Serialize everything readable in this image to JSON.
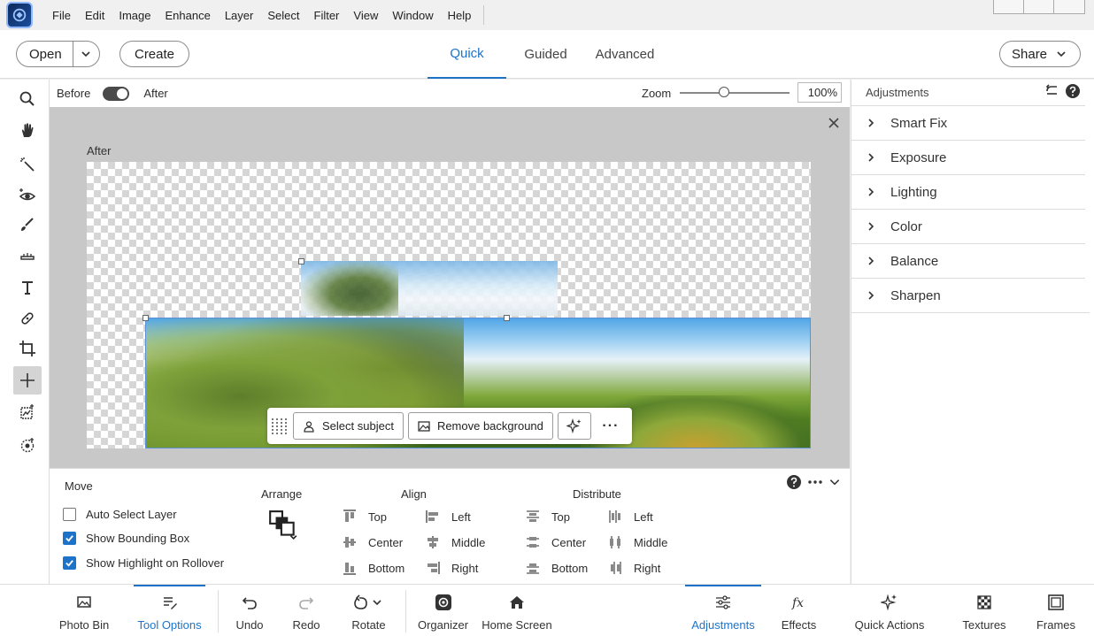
{
  "menu": {
    "items": [
      "File",
      "Edit",
      "Image",
      "Enhance",
      "Layer",
      "Select",
      "Filter",
      "View",
      "Window",
      "Help"
    ]
  },
  "modebar": {
    "open_label": "Open",
    "create_label": "Create",
    "share_label": "Share",
    "tabs": [
      {
        "label": "Quick",
        "active": true
      },
      {
        "label": "Guided",
        "active": false
      },
      {
        "label": "Advanced",
        "active": false
      }
    ]
  },
  "viewbar": {
    "before_label": "Before",
    "after_label": "After",
    "zoom_label": "Zoom",
    "zoom_value": "100%",
    "zoom_fraction": 0.4
  },
  "canvas": {
    "view_label": "After"
  },
  "taskbar": {
    "select_subject": "Select subject",
    "remove_background": "Remove background",
    "more": "···"
  },
  "adjustments": {
    "title": "Adjustments",
    "items": [
      "Smart Fix",
      "Exposure",
      "Lighting",
      "Color",
      "Balance",
      "Sharpen"
    ]
  },
  "tool_options": {
    "title": "Move",
    "checkboxes": [
      {
        "label": "Auto Select Layer",
        "checked": false
      },
      {
        "label": "Show Bounding Box",
        "checked": true
      },
      {
        "label": "Show Highlight on Rollover",
        "checked": true
      }
    ],
    "arrange_title": "Arrange",
    "align_title": "Align",
    "distribute_title": "Distribute",
    "align_col1": [
      "Top",
      "Center",
      "Bottom"
    ],
    "align_col2": [
      "Left",
      "Middle",
      "Right"
    ],
    "dist_col1": [
      "Top",
      "Center",
      "Bottom"
    ],
    "dist_col2": [
      "Left",
      "Middle",
      "Right"
    ]
  },
  "bottombar": {
    "photo_bin": "Photo Bin",
    "tool_options": "Tool Options",
    "undo": "Undo",
    "redo": "Redo",
    "rotate": "Rotate",
    "organizer": "Organizer",
    "home_screen": "Home Screen",
    "adjustments": "Adjustments",
    "effects": "Effects",
    "quick_actions": "Quick Actions",
    "textures": "Textures",
    "frames": "Frames"
  },
  "colors": {
    "accent": "#1e73c8"
  }
}
